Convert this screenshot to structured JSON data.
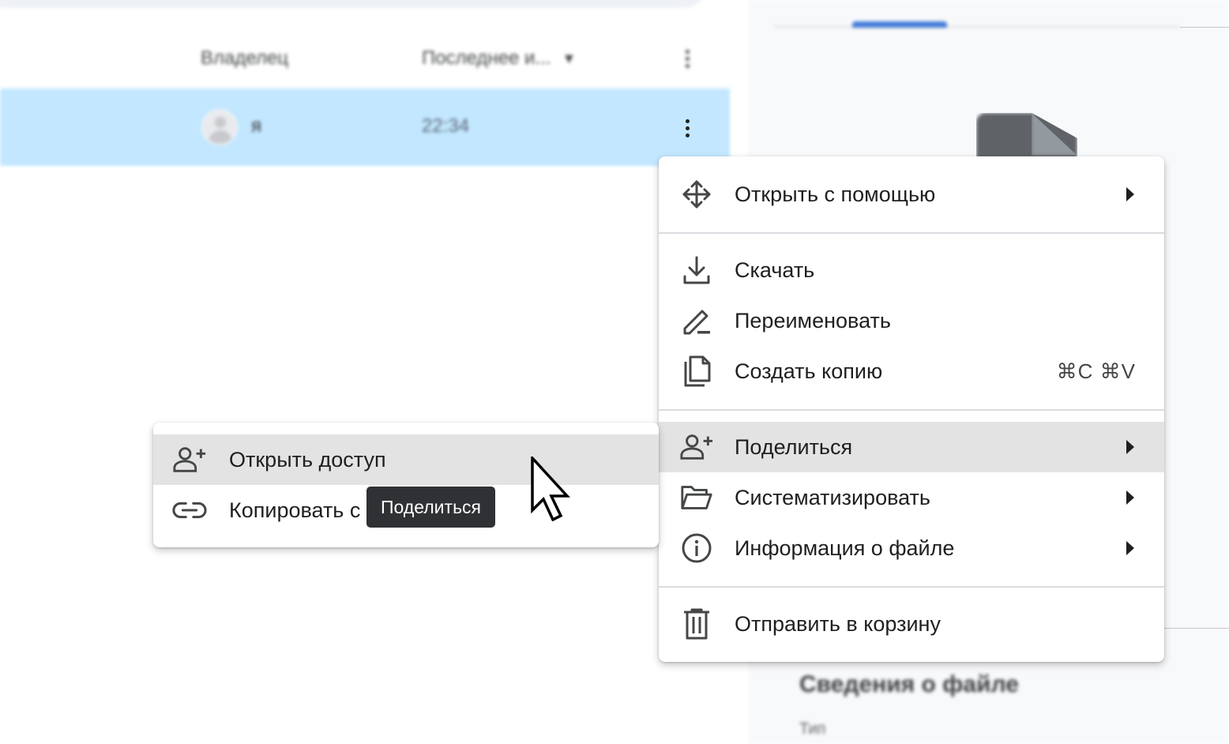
{
  "file_list": {
    "columns": {
      "owner": "Владелец",
      "modified": "Последнее и..."
    },
    "selected_row": {
      "owner": "я",
      "modified": "22:34"
    }
  },
  "details_panel": {
    "section_title": "Сведения о файле",
    "type_label": "Тип"
  },
  "context_menu": {
    "open_with": "Открыть с помощью",
    "download": "Скачать",
    "rename": "Переименовать",
    "make_copy": "Создать копию",
    "make_copy_shortcut": "⌘C ⌘V",
    "share": "Поделиться",
    "organize": "Систематизировать",
    "file_info": "Информация о файле",
    "trash": "Отправить в корзину"
  },
  "share_submenu": {
    "share_access": "Открыть доступ",
    "copy_link": "Копировать с"
  },
  "tooltip": {
    "text": "Поделиться"
  },
  "colors": {
    "selected_row": "#c2e7ff",
    "active_item": "#e3e3e3",
    "tooltip_bg": "#303134"
  }
}
